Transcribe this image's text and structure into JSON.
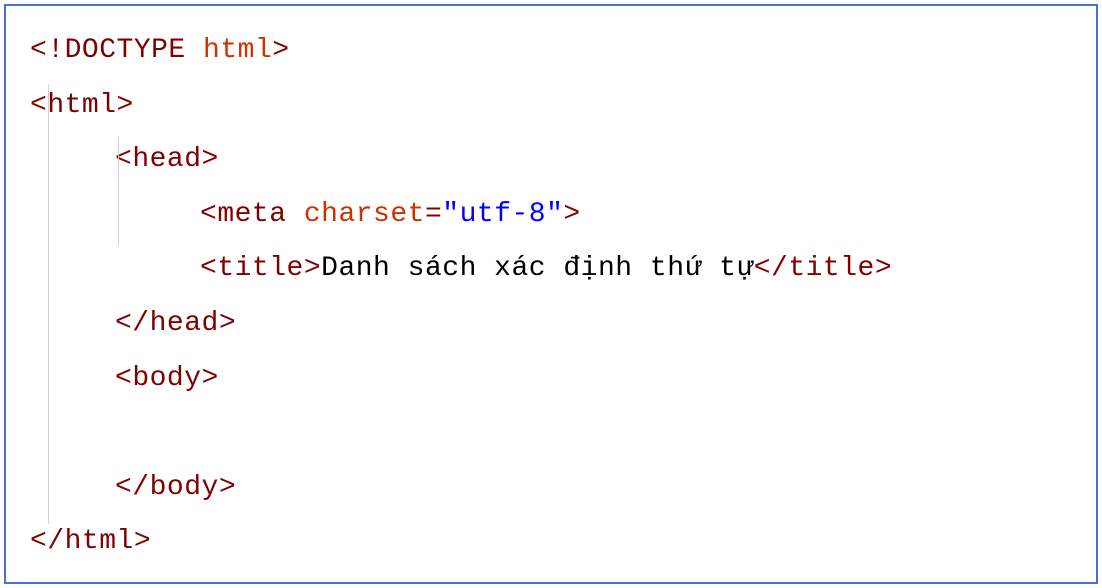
{
  "code": {
    "line1": {
      "open_bracket": "<!",
      "doctype": "DOCTYPE",
      "space": " ",
      "html_kw": "html",
      "close_bracket": ">"
    },
    "line2": {
      "open_bracket": "<",
      "tag": "html",
      "close_bracket": ">"
    },
    "line3": {
      "open_bracket": "<",
      "tag": "head",
      "close_bracket": ">"
    },
    "line4": {
      "open_bracket": "<",
      "tag": "meta",
      "space": " ",
      "attr": "charset",
      "equals": "=",
      "value": "\"utf-8\"",
      "close_bracket": ">"
    },
    "line5": {
      "open_bracket": "<",
      "open_tag": "title",
      "open_close_bracket": ">",
      "text": "Danh sách xác định thứ tự",
      "close_open_bracket": "</",
      "close_tag": "title",
      "close_bracket": ">"
    },
    "line6": {
      "open_bracket": "</",
      "tag": "head",
      "close_bracket": ">"
    },
    "line7": {
      "open_bracket": "<",
      "tag": "body",
      "close_bracket": ">"
    },
    "line8": {
      "empty": ""
    },
    "line9": {
      "open_bracket": "</",
      "tag": "body",
      "close_bracket": ">"
    },
    "line10": {
      "open_bracket": "</",
      "tag": "html",
      "close_bracket": ">"
    }
  }
}
